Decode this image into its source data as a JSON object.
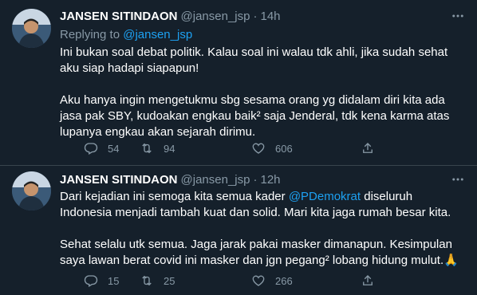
{
  "tweets": [
    {
      "name": "JANSEN SITINDAON",
      "handle": "@jansen_jsp",
      "dot": "·",
      "time": "14h",
      "reply_prefix": "Replying to ",
      "reply_to": "@jansen_jsp",
      "paragraphs": [
        "Ini bukan soal debat politik. Kalau soal ini walau tdk ahli, jika sudah sehat aku siap hadapi siapapun!",
        "Aku hanya ingin mengetukmu sbg sesama orang yg didalam diri kita ada jasa pak SBY, kudoakan engkau baik² saja Jenderal, tdk kena karma atas lupanya engkau akan sejarah dirimu."
      ],
      "replies": "54",
      "retweets": "94",
      "likes": "606"
    },
    {
      "name": "JANSEN SITINDAON",
      "handle": "@jansen_jsp",
      "dot": "·",
      "time": "12h",
      "p1_before": "Dari kejadian ini semoga kita semua kader ",
      "p1_mention": "@PDemokrat",
      "p1_after": " diseluruh Indonesia menjadi tambah kuat dan solid. Mari kita jaga rumah besar kita.",
      "p2": "Sehat selalu utk semua. Jaga jarak pakai masker dimanapun. Kesimpulan saya lawan berat covid ini masker dan jgn pegang² lobang hidung mulut.🙏",
      "replies": "15",
      "retweets": "25",
      "likes": "266"
    }
  ],
  "colors": {
    "background": "#15202b",
    "text": "#ffffff",
    "muted": "#8899a6",
    "link": "#1da1f2",
    "divider": "#38444d"
  },
  "icons": [
    "avatar",
    "more-icon",
    "reply-icon",
    "retweet-icon",
    "like-icon",
    "share-icon"
  ]
}
